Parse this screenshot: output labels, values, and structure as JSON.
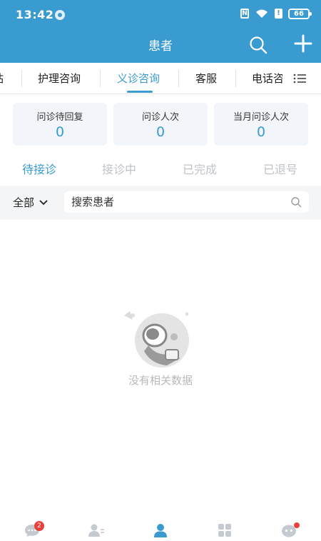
{
  "status_bar": {
    "time": "13:42",
    "battery": "66"
  },
  "nav": {
    "title": "患者"
  },
  "top_tabs": [
    {
      "label": "站"
    },
    {
      "label": "护理咨询"
    },
    {
      "label": "义诊咨询"
    },
    {
      "label": "客服"
    },
    {
      "label": "电话咨"
    }
  ],
  "active_top_tab": "义诊咨询",
  "stats": [
    {
      "label": "问诊待回复",
      "value": "0"
    },
    {
      "label": "问诊人次",
      "value": "0"
    },
    {
      "label": "当月问诊人次",
      "value": "0"
    }
  ],
  "sub_tabs": [
    {
      "label": "待接诊"
    },
    {
      "label": "接诊中"
    },
    {
      "label": "已完成"
    },
    {
      "label": "已退号"
    }
  ],
  "active_sub_tab": "待接诊",
  "filter": {
    "selected": "全部",
    "search_placeholder": "搜索患者"
  },
  "empty_state": {
    "message": "没有相关数据"
  },
  "bottom_nav": {
    "items": [
      {
        "icon": "chat-bubble-icon",
        "badge": "2"
      },
      {
        "icon": "patient-list-icon"
      },
      {
        "icon": "person-icon"
      },
      {
        "icon": "apps-grid-icon"
      },
      {
        "icon": "robot-icon"
      }
    ]
  },
  "colors": {
    "accent": "#3a9bd0",
    "badge": "#e8413c"
  }
}
